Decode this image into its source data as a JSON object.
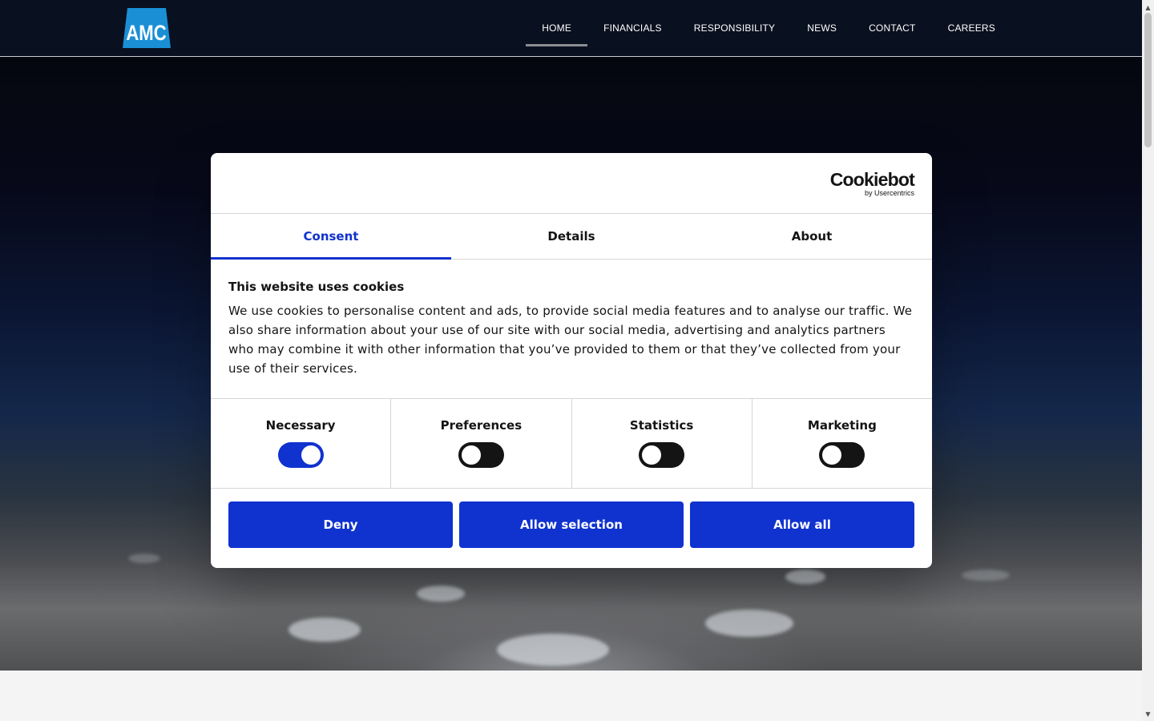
{
  "header": {
    "logo_text": "AMC",
    "nav": [
      {
        "label": "HOME",
        "active": true
      },
      {
        "label": "FINANCIALS",
        "active": false
      },
      {
        "label": "RESPONSIBILITY",
        "active": false
      },
      {
        "label": "NEWS",
        "active": false
      },
      {
        "label": "CONTACT",
        "active": false
      },
      {
        "label": "CAREERS",
        "active": false
      }
    ]
  },
  "cookie_dialog": {
    "brand": {
      "name": "Cookiebot",
      "tagline": "by Usercentrics"
    },
    "tabs": [
      {
        "label": "Consent",
        "active": true
      },
      {
        "label": "Details",
        "active": false
      },
      {
        "label": "About",
        "active": false
      }
    ],
    "title": "This website uses cookies",
    "description": "We use cookies to personalise content and ads, to provide social media features and to analyse our traffic. We also share information about your use of our site with our social media, advertising and analytics partners who may combine it with other information that you’ve provided to them or that they’ve collected from your use of their services.",
    "toggles": [
      {
        "label": "Necessary",
        "checked": true
      },
      {
        "label": "Preferences",
        "checked": false
      },
      {
        "label": "Statistics",
        "checked": false
      },
      {
        "label": "Marketing",
        "checked": false
      }
    ],
    "buttons": {
      "deny": "Deny",
      "allow_selection": "Allow selection",
      "allow_all": "Allow all"
    }
  },
  "colors": {
    "accent": "#1032cf",
    "header_bg": "#09101f",
    "toggle_off": "#141414"
  }
}
